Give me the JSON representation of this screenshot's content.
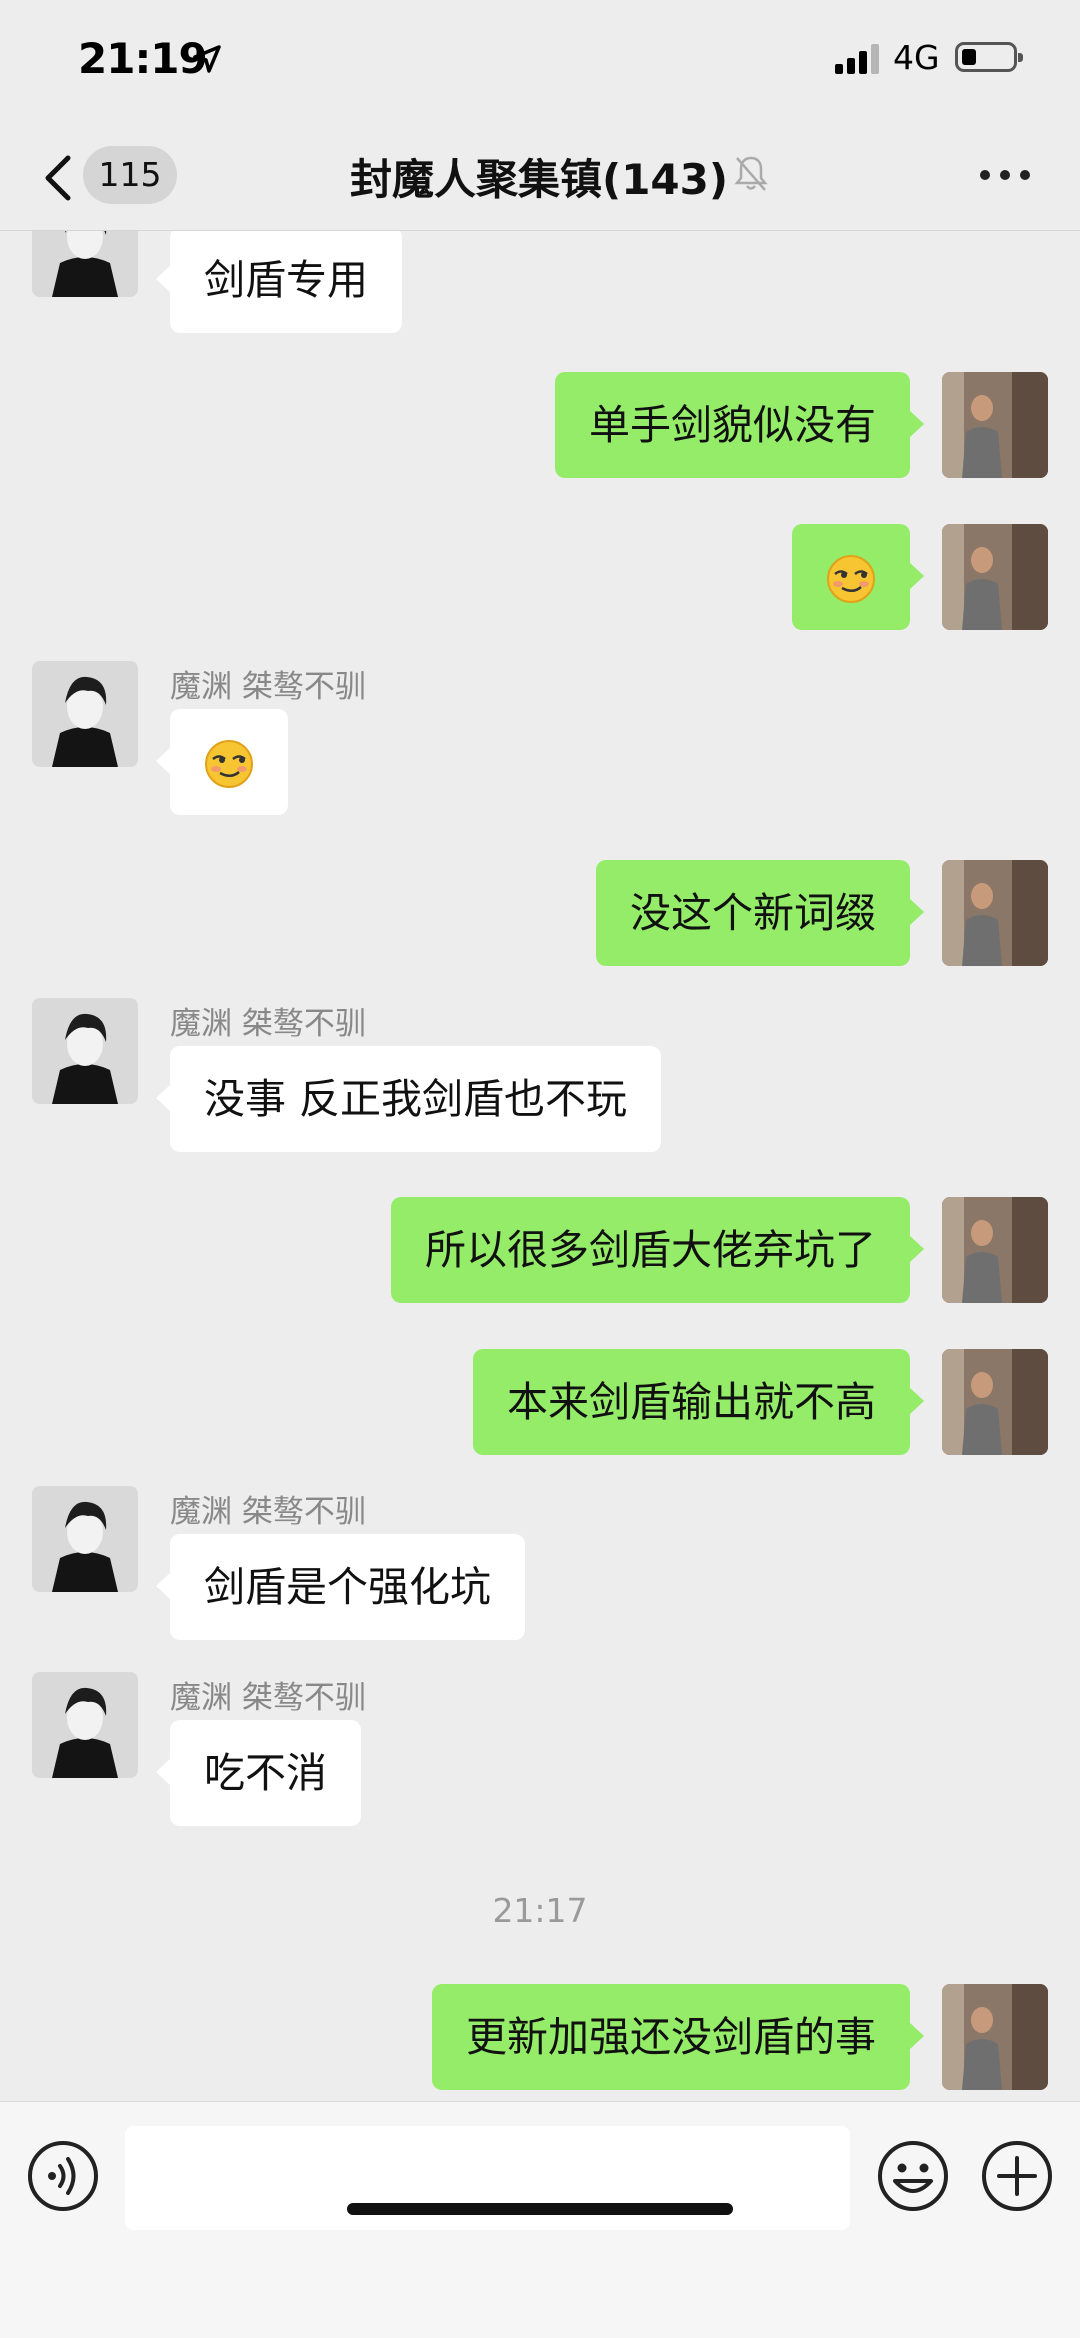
{
  "status_bar": {
    "time": "21:19",
    "network": "4G",
    "battery_level": 0.2
  },
  "header": {
    "unread_count": "115",
    "title": "封魔人聚集镇(143)"
  },
  "messages": [
    {
      "side": "in",
      "text": "剑盾专用"
    },
    {
      "side": "out",
      "text": "单手剑貌似没有"
    },
    {
      "side": "out",
      "emoji": "smirk-emoji"
    },
    {
      "side": "in",
      "sender": "魔渊  桀骜不驯",
      "emoji": "smirk-emoji"
    },
    {
      "side": "out",
      "text": "没这个新词缀"
    },
    {
      "side": "in",
      "sender": "魔渊  桀骜不驯",
      "text": "没事 反正我剑盾也不玩"
    },
    {
      "side": "out",
      "text": "所以很多剑盾大佬弃坑了"
    },
    {
      "side": "out",
      "text": "本来剑盾输出就不高"
    },
    {
      "side": "in",
      "sender": "魔渊  桀骜不驯",
      "text": "剑盾是个强化坑"
    },
    {
      "side": "in",
      "sender": "魔渊  桀骜不驯",
      "text": "吃不消"
    },
    {
      "timestamp": "21:17"
    },
    {
      "side": "out",
      "text": "更新加强还没剑盾的事"
    }
  ],
  "input_bar": {
    "draft": ""
  },
  "colors": {
    "background": "#ededed",
    "outgoing_bubble": "#95ec69",
    "incoming_bubble": "#ffffff"
  }
}
